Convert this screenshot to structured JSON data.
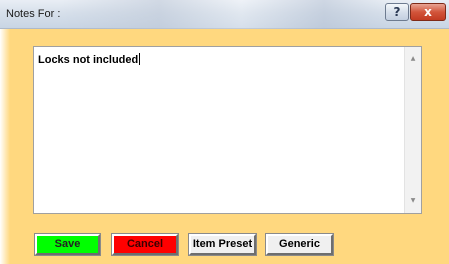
{
  "window": {
    "title": "Notes For :"
  },
  "caption_buttons": {
    "help": "?",
    "close": "x"
  },
  "notes": {
    "text": "Locks not included"
  },
  "scrollbar": {
    "up_glyph": "▲",
    "down_glyph": "▼"
  },
  "buttons": {
    "save": "Save",
    "cancel": "Cancel",
    "item_preset": "Item Preset",
    "generic": "Generic"
  },
  "colors": {
    "window_background": "#ffd87f",
    "save_button": "#00ff00",
    "cancel_button": "#ff0000",
    "neutral_button": "#f0f0f0"
  }
}
